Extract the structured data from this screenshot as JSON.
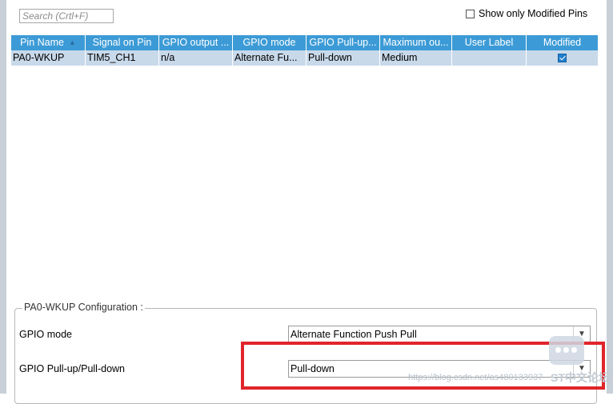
{
  "search": {
    "placeholder": "Search (Crtl+F)"
  },
  "filter": {
    "show_modified_label": "Show only Modified Pins"
  },
  "table": {
    "columns": [
      "Pin Name",
      "Signal on Pin",
      "GPIO output ...",
      "GPIO mode",
      "GPIO Pull-up...",
      "Maximum ou...",
      "User Label",
      "Modified"
    ],
    "rows": [
      {
        "pin": "PA0-WKUP",
        "signal": "TIM5_CH1",
        "output": "n/a",
        "mode": "Alternate Fu...",
        "pull": "Pull-down",
        "max": "Medium",
        "label": "",
        "modified": true
      }
    ]
  },
  "config": {
    "title": "PA0-WKUP Configuration :",
    "gpio_mode_label": "GPIO mode",
    "gpio_mode_value": "Alternate Function Push Pull",
    "pull_label": "GPIO Pull-up/Pull-down",
    "pull_value": "Pull-down"
  },
  "watermark": {
    "url": "https://blog.csdn.net/as480133937",
    "brand": "ST中文论坛"
  },
  "colors": {
    "header": "#3c9bd6",
    "selected_row": "#c8d9ea",
    "highlight": "#e0252a"
  }
}
